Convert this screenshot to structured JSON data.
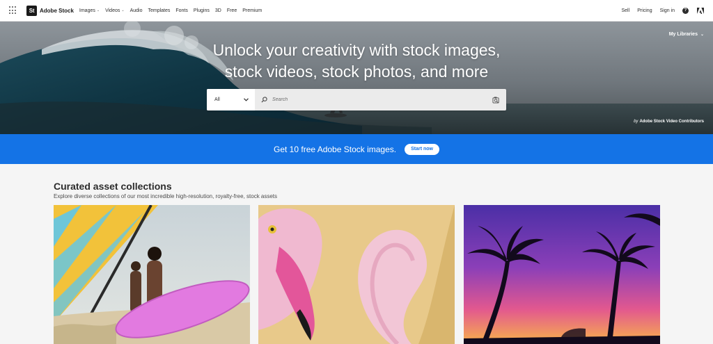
{
  "brand": {
    "logo_text": "St",
    "name": "Adobe Stock"
  },
  "nav": {
    "links": [
      {
        "label": "Images",
        "caret": "⌄"
      },
      {
        "label": "Videos",
        "caret": "⌄"
      },
      {
        "label": "Audio"
      },
      {
        "label": "Templates"
      },
      {
        "label": "Fonts"
      },
      {
        "label": "Plugins"
      },
      {
        "label": "3D"
      },
      {
        "label": "Free"
      },
      {
        "label": "Premium"
      }
    ],
    "right_links": [
      "Sell",
      "Pricing",
      "Sign in"
    ],
    "help_glyph": "?"
  },
  "hero": {
    "title_line1": "Unlock your creativity with stock images,",
    "title_line2": "stock videos, stock photos, and more",
    "my_libraries": "My Libraries",
    "search": {
      "select_value": "All",
      "placeholder": "Search"
    },
    "credit_by": "by",
    "credit_name": "Adobe Stock Video Contributors"
  },
  "promo": {
    "text": "Get 10 free Adobe Stock images.",
    "button": "Start now"
  },
  "collections": {
    "title": "Curated asset collections",
    "subtitle": "Explore diverse collections of our most incredible high-resolution, royalty-free, stock assets"
  },
  "icons": {
    "apps": "apps-grid-icon",
    "search": "search-icon",
    "visual_search": "camera-search-icon",
    "help": "help-icon",
    "adobe": "adobe-logo-icon",
    "chevron": "chevron-down-icon"
  },
  "colors": {
    "accent": "#1473e6",
    "nav_bg": "#ffffff",
    "page_bg": "#f5f5f5",
    "text": "#2c2c2c"
  }
}
